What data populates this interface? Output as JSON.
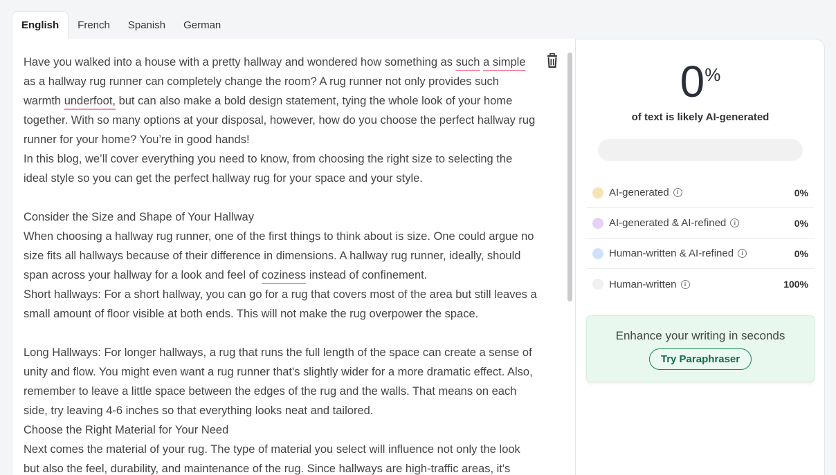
{
  "tabs": [
    "English",
    "French",
    "Spanish",
    "German"
  ],
  "editor": {
    "paragraphs": [
      "Have you walked into a house with a pretty hallway and wondered how something as such a simple as a hallway rug runner can completely change the room? A rug runner not only provides such warmth underfoot, but can also make a bold design statement, tying the whole look of your home together. With so many options at your disposal, however, how do you choose the perfect hallway rug runner for your home? You’re in good hands!",
      "In this blog, we’ll cover everything you need to know, from choosing the right size to selecting the ideal style so you can get the perfect hallway rug for your space and your style.",
      "",
      "Consider the Size and Shape of Your Hallway",
      "When choosing a hallway rug runner, one of the first things to think about is size. One could argue no size fits all hallways because of their difference in dimensions. A hallway rug runner, ideally, should span across your hallway for a look and feel of coziness instead of confinement.",
      "Short hallways: For a short hallway, you can go for a rug that covers most of the area but still leaves a small amount of floor visible at both ends. This will not make the rug overpower the space.",
      "",
      "Long Hallways: For longer hallways, a rug that runs the full length of the space can create a sense of unity and flow. You might even want a rug runner that's slightly wider for a more dramatic effect. Also, remember to leave a little space between the edges of the rug and the walls. That means on each side, try leaving 4-6 inches so that everything looks neat and tailored.",
      "Choose the Right Material for Your Need",
      "Next comes the material of your rug. The type of material you select will influence not only the look but also the feel, durability, and maintenance of the rug. Since hallways are high-traffic areas, it's"
    ],
    "flagged_words": [
      "such",
      "a simple",
      "underfoot,",
      "coziness"
    ]
  },
  "results": {
    "score": "0",
    "score_unit": "%",
    "caption": "of text is likely AI-generated",
    "ai_fraction": 0,
    "rows": [
      {
        "label": "AI-generated",
        "value": "0%",
        "color": "#f6e3b4"
      },
      {
        "label": "AI-generated & AI-refined",
        "value": "0%",
        "color": "#e4d3f5"
      },
      {
        "label": "Human-written & AI-refined",
        "value": "0%",
        "color": "#cfe2fa"
      },
      {
        "label": "Human-written",
        "value": "100%",
        "color": "#f0f0f0"
      }
    ]
  },
  "promo": {
    "title": "Enhance your writing in seconds",
    "button": "Try Paraphraser"
  }
}
